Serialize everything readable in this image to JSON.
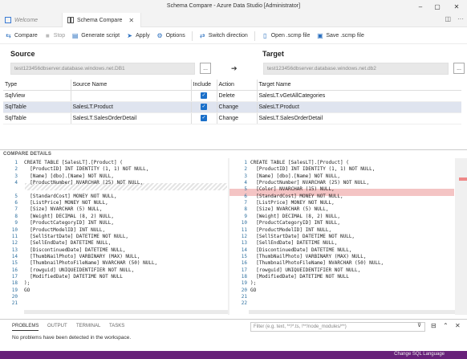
{
  "window": {
    "title": "Schema Compare - Azure Data Studio [Administrator]"
  },
  "tabs": [
    {
      "label": "Welcome",
      "active": false
    },
    {
      "label": "Schema Compare",
      "active": true
    }
  ],
  "toolbar": {
    "compare": "Compare",
    "stop": "Stop",
    "generate_script": "Generate script",
    "apply": "Apply",
    "options": "Options",
    "switch_direction": "Switch direction",
    "open_scmp": "Open .scmp file",
    "save_scmp": "Save .scmp file"
  },
  "source": {
    "label": "Source",
    "value": "test123456dbserver.database.windows.net.DB1",
    "browse": "..."
  },
  "target": {
    "label": "Target",
    "value": "test123456dbserver.database.windows.net.db2",
    "browse": "..."
  },
  "arrow": "➔",
  "results": {
    "headers": [
      "Type",
      "Source Name",
      "Include",
      "Action",
      "Target Name"
    ],
    "rows": [
      {
        "type": "SqlView",
        "source": "",
        "include": true,
        "action": "Delete",
        "target": "SalesLT.vGetAllCategories"
      },
      {
        "type": "SqlTable",
        "source": "SalesLT.Product",
        "include": true,
        "action": "Change",
        "target": "SalesLT.Product"
      },
      {
        "type": "SqlTable",
        "source": "SalesLT.SalesOrderDetail",
        "include": true,
        "action": "Change",
        "target": "SalesLT.SalesOrderDetail"
      }
    ]
  },
  "compare_details": {
    "title": "COMPARE DETAILS",
    "left_lines": [
      {
        "n": "1",
        "t": "CREATE TABLE [SalesLT].[Product] ("
      },
      {
        "n": "2",
        "t": "  [ProductID] INT IDENTITY (1, 1) NOT NULL,"
      },
      {
        "n": "3",
        "t": "  [Name] [dbo].[Name] NOT NULL,"
      },
      {
        "n": "4",
        "t": "  [ProductNumber] NVARCHAR (25) NOT NULL,"
      },
      {
        "n": "",
        "t": ""
      },
      {
        "n": "5",
        "t": "  [StandardCost] MONEY NOT NULL,"
      },
      {
        "n": "6",
        "t": "  [ListPrice] MONEY NOT NULL,"
      },
      {
        "n": "7",
        "t": "  [Size] NVARCHAR (5) NULL,"
      },
      {
        "n": "8",
        "t": "  [Weight] DECIMAL (8, 2) NULL,"
      },
      {
        "n": "9",
        "t": "  [ProductCategoryID] INT NULL,"
      },
      {
        "n": "10",
        "t": "  [ProductModelID] INT NULL,"
      },
      {
        "n": "11",
        "t": "  [SellStartDate] DATETIME NOT NULL,"
      },
      {
        "n": "12",
        "t": "  [SellEndDate] DATETIME NULL,"
      },
      {
        "n": "13",
        "t": "  [DiscontinuedDate] DATETIME NULL,"
      },
      {
        "n": "14",
        "t": "  [ThumbNailPhoto] VARBINARY (MAX) NULL,"
      },
      {
        "n": "15",
        "t": "  [ThumbnailPhotoFileName] NVARCHAR (50) NULL,"
      },
      {
        "n": "16",
        "t": "  [rowguid] UNIQUEIDENTIFIER NOT NULL,"
      },
      {
        "n": "17",
        "t": "  [ModifiedDate] DATETIME NOT NULL"
      },
      {
        "n": "18",
        "t": ");"
      },
      {
        "n": "19",
        "t": "GO"
      },
      {
        "n": "20",
        "t": ""
      },
      {
        "n": "21",
        "t": ""
      }
    ],
    "right_lines": [
      {
        "n": "1",
        "t": "CREATE TABLE [SalesLT].[Product] ("
      },
      {
        "n": "2",
        "t": "  [ProductID] INT IDENTITY (1, 1) NOT NULL,"
      },
      {
        "n": "3",
        "t": "  [Name] [dbo].[Name] NOT NULL,"
      },
      {
        "n": "4",
        "t": "  [ProductNumber] NVARCHAR (25) NOT NULL,"
      },
      {
        "n": "5",
        "t": "  [Color] NVARCHAR (15) NULL,"
      },
      {
        "n": "6",
        "t": "  [StandardCost] MONEY NOT NULL,"
      },
      {
        "n": "7",
        "t": "  [ListPrice] MONEY NOT NULL,"
      },
      {
        "n": "8",
        "t": "  [Size] NVARCHAR (5) NULL,"
      },
      {
        "n": "9",
        "t": "  [Weight] DECIMAL (8, 2) NULL,"
      },
      {
        "n": "10",
        "t": "  [ProductCategoryID] INT NULL,"
      },
      {
        "n": "11",
        "t": "  [ProductModelID] INT NULL,"
      },
      {
        "n": "12",
        "t": "  [SellStartDate] DATETIME NOT NULL,"
      },
      {
        "n": "13",
        "t": "  [SellEndDate] DATETIME NULL,"
      },
      {
        "n": "14",
        "t": "  [DiscontinuedDate] DATETIME NULL,"
      },
      {
        "n": "15",
        "t": "  [ThumbNailPhoto] VARBINARY (MAX) NULL,"
      },
      {
        "n": "16",
        "t": "  [ThumbnailPhotoFileName] NVARCHAR (50) NULL,"
      },
      {
        "n": "17",
        "t": "  [rowguid] UNIQUEIDENTIFIER NOT NULL,"
      },
      {
        "n": "18",
        "t": "  [ModifiedDate] DATETIME NOT NULL"
      },
      {
        "n": "19",
        "t": ");"
      },
      {
        "n": "20",
        "t": "GO"
      },
      {
        "n": "21",
        "t": ""
      },
      {
        "n": "22",
        "t": ""
      }
    ]
  },
  "panel": {
    "tabs": [
      "PROBLEMS",
      "OUTPUT",
      "TERMINAL",
      "TASKS"
    ],
    "active_tab": "PROBLEMS",
    "message": "No problems have been detected in the workspace.",
    "filter_placeholder": "Filter (e.g. text, **/*.ts, !**/node_modules/**)"
  },
  "statusbar": {
    "text": "Change SQL Language"
  },
  "colors": {
    "accent": "#1a6fc9",
    "statusbar": "#68217a",
    "diff_added": "#f4c4c4"
  }
}
